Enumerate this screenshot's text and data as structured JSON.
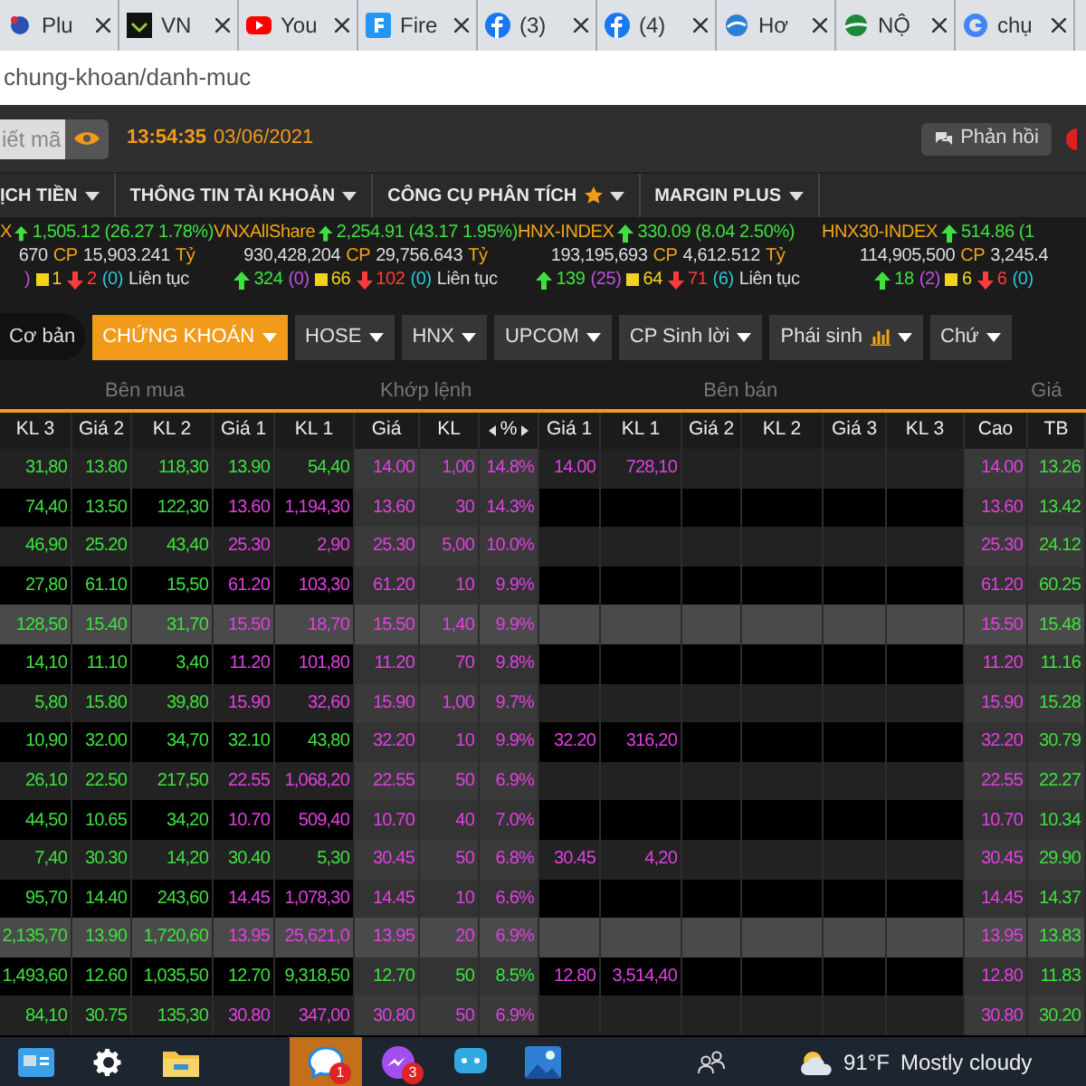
{
  "browser": {
    "tabs": [
      {
        "title": "Plu"
      },
      {
        "title": "VN"
      },
      {
        "title": "You"
      },
      {
        "title": "Fire"
      },
      {
        "title": "(3)"
      },
      {
        "title": "(4)"
      },
      {
        "title": "Hơ"
      },
      {
        "title": "NỘ"
      },
      {
        "title": "chụ"
      }
    ],
    "address": "chung-khoan/danh-muc"
  },
  "header": {
    "search_placeholder": "iết mã",
    "time": "13:54:35",
    "date": "03/06/2021",
    "feedback": "Phản hồi"
  },
  "menu": [
    {
      "label": "ỊCH TIỀN",
      "starred": false
    },
    {
      "label": "THÔNG TIN TÀI KHOẢN",
      "starred": false
    },
    {
      "label": "CÔNG CỤ PHÂN TÍCH",
      "starred": true
    },
    {
      "label": "MARGIN PLUS",
      "starred": false
    }
  ],
  "indexes": [
    {
      "name": "X",
      "change": "1,505.12 (26.27 1.78%)",
      "volume": "670",
      "cp": "CP",
      "value": "15,903.241",
      "unit": "Tỷ",
      "counts": [
        {
          "kind": "ceil",
          "text": ")"
        },
        {
          "kind": "ref",
          "text": "1"
        },
        {
          "kind": "down",
          "text": "2"
        },
        {
          "kind": "floor",
          "text": "(0)"
        }
      ],
      "status": "Liên tục"
    },
    {
      "name": "VNXAllShare",
      "change": "2,254.91 (43.17 1.95%)",
      "volume": "930,428,204",
      "cp": "CP",
      "value": "29,756.643",
      "unit": "Tỷ",
      "counts": [
        {
          "kind": "up",
          "text": "324"
        },
        {
          "kind": "ceil",
          "text": "(0)"
        },
        {
          "kind": "ref",
          "text": "66"
        },
        {
          "kind": "down",
          "text": "102"
        },
        {
          "kind": "floor",
          "text": "(0)"
        }
      ],
      "status": "Liên tục"
    },
    {
      "name": "HNX-INDEX",
      "change": "330.09 (8.04 2.50%)",
      "volume": "193,195,693",
      "cp": "CP",
      "value": "4,612.512",
      "unit": "Tỷ",
      "counts": [
        {
          "kind": "up",
          "text": "139"
        },
        {
          "kind": "ceil",
          "text": "(25)"
        },
        {
          "kind": "ref",
          "text": "64"
        },
        {
          "kind": "down",
          "text": "71"
        },
        {
          "kind": "floor",
          "text": "(6)"
        }
      ],
      "status": "Liên tục"
    },
    {
      "name": "HNX30-INDEX",
      "change": "514.86 (1",
      "volume": "114,905,500",
      "cp": "CP",
      "value": "3,245.4",
      "counts": [
        {
          "kind": "up",
          "text": "18"
        },
        {
          "kind": "ceil",
          "text": "(2)"
        },
        {
          "kind": "ref",
          "text": "6"
        },
        {
          "kind": "down",
          "text": "6"
        },
        {
          "kind": "floor",
          "text": "(0)"
        }
      ]
    }
  ],
  "basic": "Cơ bản",
  "filters": [
    {
      "label": "CHỨNG KHOÁN",
      "selected": true,
      "chart": false
    },
    {
      "label": "HOSE",
      "selected": false,
      "chart": false
    },
    {
      "label": "HNX",
      "selected": false,
      "chart": false
    },
    {
      "label": "UPCOM",
      "selected": false,
      "chart": false
    },
    {
      "label": "CP Sinh lời",
      "selected": false,
      "chart": false
    },
    {
      "label": "Phái sinh",
      "selected": false,
      "chart": true
    },
    {
      "label": "Chứ",
      "selected": false,
      "chart": false
    }
  ],
  "groups": [
    "Bên mua",
    "Khớp lệnh",
    "Bên bán",
    "Giá"
  ],
  "table": {
    "columns": [
      "KL 3",
      "Giá 2",
      "KL 2",
      "Giá 1",
      "KL 1",
      "Giá",
      "KL",
      "%",
      "Giá 1",
      "KL 1",
      "Giá 2",
      "KL 2",
      "Giá 3",
      "KL 3",
      "Cao",
      "TB"
    ],
    "rows": [
      {
        "highlighted": false,
        "cells": [
          {
            "text": "31,80",
            "color": "#3ee03e"
          },
          {
            "text": "13.80",
            "color": "#3ee03e"
          },
          {
            "text": "118,30",
            "color": "#3ee03e"
          },
          {
            "text": "13.90",
            "color": "#3ee03e"
          },
          {
            "text": "54,40",
            "color": "#3ee03e"
          },
          {
            "text": "14.00",
            "color": "#e040e0"
          },
          {
            "text": "1,00",
            "color": "#e040e0"
          },
          {
            "text": "14.8%",
            "color": "#e040e0"
          },
          {
            "text": "14.00",
            "color": "#e040e0"
          },
          {
            "text": "728,10",
            "color": "#e040e0"
          },
          null,
          null,
          null,
          null,
          {
            "text": "14.00",
            "color": "#e040e0"
          },
          {
            "text": "13.26",
            "color": "#3ee03e"
          }
        ]
      },
      {
        "highlighted": false,
        "cells": [
          {
            "text": "74,40",
            "color": "#3ee03e"
          },
          {
            "text": "13.50",
            "color": "#3ee03e"
          },
          {
            "text": "122,30",
            "color": "#3ee03e"
          },
          {
            "text": "13.60",
            "color": "#e040e0"
          },
          {
            "text": "1,194,30",
            "color": "#e040e0"
          },
          {
            "text": "13.60",
            "color": "#e040e0"
          },
          {
            "text": "30",
            "color": "#e040e0"
          },
          {
            "text": "14.3%",
            "color": "#e040e0"
          },
          null,
          null,
          null,
          null,
          null,
          null,
          {
            "text": "13.60",
            "color": "#e040e0"
          },
          {
            "text": "13.42",
            "color": "#3ee03e"
          }
        ]
      },
      {
        "highlighted": false,
        "cells": [
          {
            "text": "46,90",
            "color": "#3ee03e"
          },
          {
            "text": "25.20",
            "color": "#3ee03e"
          },
          {
            "text": "43,40",
            "color": "#3ee03e"
          },
          {
            "text": "25.30",
            "color": "#e040e0"
          },
          {
            "text": "2,90",
            "color": "#e040e0"
          },
          {
            "text": "25.30",
            "color": "#e040e0"
          },
          {
            "text": "5,00",
            "color": "#e040e0"
          },
          {
            "text": "10.0%",
            "color": "#e040e0"
          },
          null,
          null,
          null,
          null,
          null,
          null,
          {
            "text": "25.30",
            "color": "#e040e0"
          },
          {
            "text": "24.12",
            "color": "#3ee03e"
          }
        ]
      },
      {
        "highlighted": false,
        "cells": [
          {
            "text": "27,80",
            "color": "#3ee03e"
          },
          {
            "text": "61.10",
            "color": "#3ee03e"
          },
          {
            "text": "15,50",
            "color": "#3ee03e"
          },
          {
            "text": "61.20",
            "color": "#e040e0"
          },
          {
            "text": "103,30",
            "color": "#e040e0"
          },
          {
            "text": "61.20",
            "color": "#e040e0"
          },
          {
            "text": "10",
            "color": "#e040e0"
          },
          {
            "text": "9.9%",
            "color": "#e040e0"
          },
          null,
          null,
          null,
          null,
          null,
          null,
          {
            "text": "61.20",
            "color": "#e040e0"
          },
          {
            "text": "60.25",
            "color": "#3ee03e"
          }
        ]
      },
      {
        "highlighted": true,
        "cells": [
          {
            "text": "128,50",
            "color": "#3ee03e"
          },
          {
            "text": "15.40",
            "color": "#3ee03e"
          },
          {
            "text": "31,70",
            "color": "#3ee03e"
          },
          {
            "text": "15.50",
            "color": "#e040e0"
          },
          {
            "text": "18,70",
            "color": "#e040e0"
          },
          {
            "text": "15.50",
            "color": "#e040e0"
          },
          {
            "text": "1,40",
            "color": "#e040e0"
          },
          {
            "text": "9.9%",
            "color": "#e040e0"
          },
          null,
          null,
          null,
          null,
          null,
          null,
          {
            "text": "15.50",
            "color": "#e040e0"
          },
          {
            "text": "15.48",
            "color": "#3ee03e"
          }
        ]
      },
      {
        "highlighted": false,
        "cells": [
          {
            "text": "14,10",
            "color": "#3ee03e"
          },
          {
            "text": "11.10",
            "color": "#3ee03e"
          },
          {
            "text": "3,40",
            "color": "#3ee03e"
          },
          {
            "text": "11.20",
            "color": "#e040e0"
          },
          {
            "text": "101,80",
            "color": "#e040e0"
          },
          {
            "text": "11.20",
            "color": "#e040e0"
          },
          {
            "text": "70",
            "color": "#e040e0"
          },
          {
            "text": "9.8%",
            "color": "#e040e0"
          },
          null,
          null,
          null,
          null,
          null,
          null,
          {
            "text": "11.20",
            "color": "#e040e0"
          },
          {
            "text": "11.16",
            "color": "#3ee03e"
          }
        ]
      },
      {
        "highlighted": false,
        "cells": [
          {
            "text": "5,80",
            "color": "#3ee03e"
          },
          {
            "text": "15.80",
            "color": "#3ee03e"
          },
          {
            "text": "39,80",
            "color": "#3ee03e"
          },
          {
            "text": "15.90",
            "color": "#e040e0"
          },
          {
            "text": "32,60",
            "color": "#e040e0"
          },
          {
            "text": "15.90",
            "color": "#e040e0"
          },
          {
            "text": "1,00",
            "color": "#e040e0"
          },
          {
            "text": "9.7%",
            "color": "#e040e0"
          },
          null,
          null,
          null,
          null,
          null,
          null,
          {
            "text": "15.90",
            "color": "#e040e0"
          },
          {
            "text": "15.28",
            "color": "#3ee03e"
          }
        ]
      },
      {
        "highlighted": false,
        "cells": [
          {
            "text": "10,90",
            "color": "#3ee03e"
          },
          {
            "text": "32.00",
            "color": "#3ee03e"
          },
          {
            "text": "34,70",
            "color": "#3ee03e"
          },
          {
            "text": "32.10",
            "color": "#3ee03e"
          },
          {
            "text": "43,80",
            "color": "#3ee03e"
          },
          {
            "text": "32.20",
            "color": "#e040e0"
          },
          {
            "text": "10",
            "color": "#e040e0"
          },
          {
            "text": "9.9%",
            "color": "#e040e0"
          },
          {
            "text": "32.20",
            "color": "#e040e0"
          },
          {
            "text": "316,20",
            "color": "#e040e0"
          },
          null,
          null,
          null,
          null,
          {
            "text": "32.20",
            "color": "#e040e0"
          },
          {
            "text": "30.79",
            "color": "#3ee03e"
          }
        ]
      },
      {
        "highlighted": false,
        "cells": [
          {
            "text": "26,10",
            "color": "#3ee03e"
          },
          {
            "text": "22.50",
            "color": "#3ee03e"
          },
          {
            "text": "217,50",
            "color": "#3ee03e"
          },
          {
            "text": "22.55",
            "color": "#e040e0"
          },
          {
            "text": "1,068,20",
            "color": "#e040e0"
          },
          {
            "text": "22.55",
            "color": "#e040e0"
          },
          {
            "text": "50",
            "color": "#e040e0"
          },
          {
            "text": "6.9%",
            "color": "#e040e0"
          },
          null,
          null,
          null,
          null,
          null,
          null,
          {
            "text": "22.55",
            "color": "#e040e0"
          },
          {
            "text": "22.27",
            "color": "#3ee03e"
          }
        ]
      },
      {
        "highlighted": false,
        "cells": [
          {
            "text": "44,50",
            "color": "#3ee03e"
          },
          {
            "text": "10.65",
            "color": "#3ee03e"
          },
          {
            "text": "34,20",
            "color": "#3ee03e"
          },
          {
            "text": "10.70",
            "color": "#e040e0"
          },
          {
            "text": "509,40",
            "color": "#e040e0"
          },
          {
            "text": "10.70",
            "color": "#e040e0"
          },
          {
            "text": "40",
            "color": "#e040e0"
          },
          {
            "text": "7.0%",
            "color": "#e040e0"
          },
          null,
          null,
          null,
          null,
          null,
          null,
          {
            "text": "10.70",
            "color": "#e040e0"
          },
          {
            "text": "10.34",
            "color": "#3ee03e"
          }
        ]
      },
      {
        "highlighted": false,
        "cells": [
          {
            "text": "7,40",
            "color": "#3ee03e"
          },
          {
            "text": "30.30",
            "color": "#3ee03e"
          },
          {
            "text": "14,20",
            "color": "#3ee03e"
          },
          {
            "text": "30.40",
            "color": "#3ee03e"
          },
          {
            "text": "5,30",
            "color": "#3ee03e"
          },
          {
            "text": "30.45",
            "color": "#e040e0"
          },
          {
            "text": "50",
            "color": "#e040e0"
          },
          {
            "text": "6.8%",
            "color": "#e040e0"
          },
          {
            "text": "30.45",
            "color": "#e040e0"
          },
          {
            "text": "4,20",
            "color": "#e040e0"
          },
          null,
          null,
          null,
          null,
          {
            "text": "30.45",
            "color": "#e040e0"
          },
          {
            "text": "29.90",
            "color": "#3ee03e"
          }
        ]
      },
      {
        "highlighted": false,
        "cells": [
          {
            "text": "95,70",
            "color": "#3ee03e"
          },
          {
            "text": "14.40",
            "color": "#3ee03e"
          },
          {
            "text": "243,60",
            "color": "#3ee03e"
          },
          {
            "text": "14.45",
            "color": "#e040e0"
          },
          {
            "text": "1,078,30",
            "color": "#e040e0"
          },
          {
            "text": "14.45",
            "color": "#e040e0"
          },
          {
            "text": "10",
            "color": "#e040e0"
          },
          {
            "text": "6.6%",
            "color": "#e040e0"
          },
          null,
          null,
          null,
          null,
          null,
          null,
          {
            "text": "14.45",
            "color": "#e040e0"
          },
          {
            "text": "14.37",
            "color": "#3ee03e"
          }
        ]
      },
      {
        "highlighted": true,
        "cells": [
          {
            "text": "2,135,70",
            "color": "#3ee03e"
          },
          {
            "text": "13.90",
            "color": "#3ee03e"
          },
          {
            "text": "1,720,60",
            "color": "#3ee03e"
          },
          {
            "text": "13.95",
            "color": "#e040e0"
          },
          {
            "text": "25,621,0",
            "color": "#e040e0"
          },
          {
            "text": "13.95",
            "color": "#e040e0"
          },
          {
            "text": "20",
            "color": "#e040e0"
          },
          {
            "text": "6.9%",
            "color": "#e040e0"
          },
          null,
          null,
          null,
          null,
          null,
          null,
          {
            "text": "13.95",
            "color": "#e040e0"
          },
          {
            "text": "13.83",
            "color": "#3ee03e"
          }
        ]
      },
      {
        "highlighted": false,
        "cells": [
          {
            "text": "1,493,60",
            "color": "#3ee03e"
          },
          {
            "text": "12.60",
            "color": "#3ee03e"
          },
          {
            "text": "1,035,50",
            "color": "#3ee03e"
          },
          {
            "text": "12.70",
            "color": "#3ee03e"
          },
          {
            "text": "9,318,50",
            "color": "#3ee03e"
          },
          {
            "text": "12.70",
            "color": "#3ee03e"
          },
          {
            "text": "50",
            "color": "#3ee03e"
          },
          {
            "text": "8.5%",
            "color": "#3ee03e"
          },
          {
            "text": "12.80",
            "color": "#e040e0"
          },
          {
            "text": "3,514,40",
            "color": "#e040e0"
          },
          null,
          null,
          null,
          null,
          {
            "text": "12.80",
            "color": "#e040e0"
          },
          {
            "text": "11.83",
            "color": "#3ee03e"
          }
        ]
      },
      {
        "highlighted": false,
        "cells": [
          {
            "text": "84,10",
            "color": "#3ee03e"
          },
          {
            "text": "30.75",
            "color": "#3ee03e"
          },
          {
            "text": "135,30",
            "color": "#3ee03e"
          },
          {
            "text": "30.80",
            "color": "#e040e0"
          },
          {
            "text": "347,00",
            "color": "#e040e0"
          },
          {
            "text": "30.80",
            "color": "#e040e0"
          },
          {
            "text": "50",
            "color": "#e040e0"
          },
          {
            "text": "6.9%",
            "color": "#e040e0"
          },
          null,
          null,
          null,
          null,
          null,
          null,
          {
            "text": "30.80",
            "color": "#e040e0"
          },
          {
            "text": "30.20",
            "color": "#3ee03e"
          }
        ]
      }
    ]
  },
  "taskbar": {
    "apps": [
      {
        "kind": "card",
        "active": false
      },
      {
        "kind": "gear",
        "active": false
      },
      {
        "kind": "folder",
        "active": false
      },
      {
        "kind": "zalo",
        "active": true,
        "badge": "1"
      },
      {
        "kind": "messenger",
        "active": false,
        "badge": "3"
      },
      {
        "kind": "chat",
        "active": false
      },
      {
        "kind": "photos",
        "active": false
      }
    ],
    "weather": {
      "temp": "91°F",
      "text": "Mostly cloudy"
    }
  }
}
